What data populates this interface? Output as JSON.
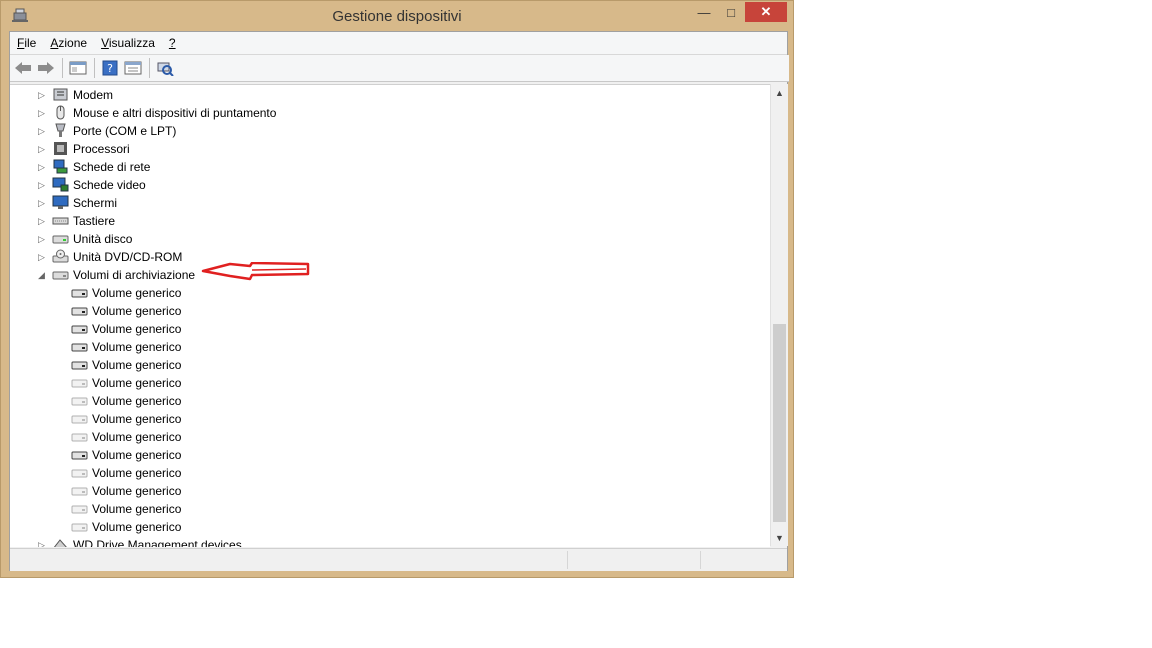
{
  "window": {
    "title": "Gestione dispositivi"
  },
  "menu": [
    {
      "pre": "",
      "u": "F",
      "post": "ile"
    },
    {
      "pre": "",
      "u": "A",
      "post": "zione"
    },
    {
      "pre": "",
      "u": "V",
      "post": "isualizza"
    },
    {
      "pre": "",
      "u": "?",
      "post": ""
    }
  ],
  "tree": {
    "categories": [
      {
        "label": "Modem",
        "icon": "modem-icon"
      },
      {
        "label": "Mouse e altri dispositivi di puntamento",
        "icon": "mouse-icon"
      },
      {
        "label": "Porte (COM e LPT)",
        "icon": "port-icon"
      },
      {
        "label": "Processori",
        "icon": "processor-icon"
      },
      {
        "label": "Schede di rete",
        "icon": "network-adapter-icon"
      },
      {
        "label": "Schede video",
        "icon": "display-adapter-icon"
      },
      {
        "label": "Schermi",
        "icon": "monitor-icon"
      },
      {
        "label": "Tastiere",
        "icon": "keyboard-icon"
      },
      {
        "label": "Unità disco",
        "icon": "disk-drive-icon"
      },
      {
        "label": "Unità DVD/CD-ROM",
        "icon": "dvd-drive-icon"
      },
      {
        "label": "Volumi di archiviazione",
        "icon": "storage-volume-icon",
        "expanded": true
      }
    ],
    "volumes": [
      {
        "label": "Volume generico",
        "active": true
      },
      {
        "label": "Volume generico",
        "active": true
      },
      {
        "label": "Volume generico",
        "active": true
      },
      {
        "label": "Volume generico",
        "active": true
      },
      {
        "label": "Volume generico",
        "active": true
      },
      {
        "label": "Volume generico",
        "active": false
      },
      {
        "label": "Volume generico",
        "active": false
      },
      {
        "label": "Volume generico",
        "active": false
      },
      {
        "label": "Volume generico",
        "active": false
      },
      {
        "label": "Volume generico",
        "active": true
      },
      {
        "label": "Volume generico",
        "active": false
      },
      {
        "label": "Volume generico",
        "active": false
      },
      {
        "label": "Volume generico",
        "active": false
      },
      {
        "label": "Volume generico",
        "active": false
      }
    ],
    "last": {
      "label": "WD Drive Management devices",
      "icon": "wd-device-icon"
    }
  },
  "colors": {
    "frame": "#d7b98a",
    "close": "#c7443a",
    "annotation": "#e02020"
  }
}
